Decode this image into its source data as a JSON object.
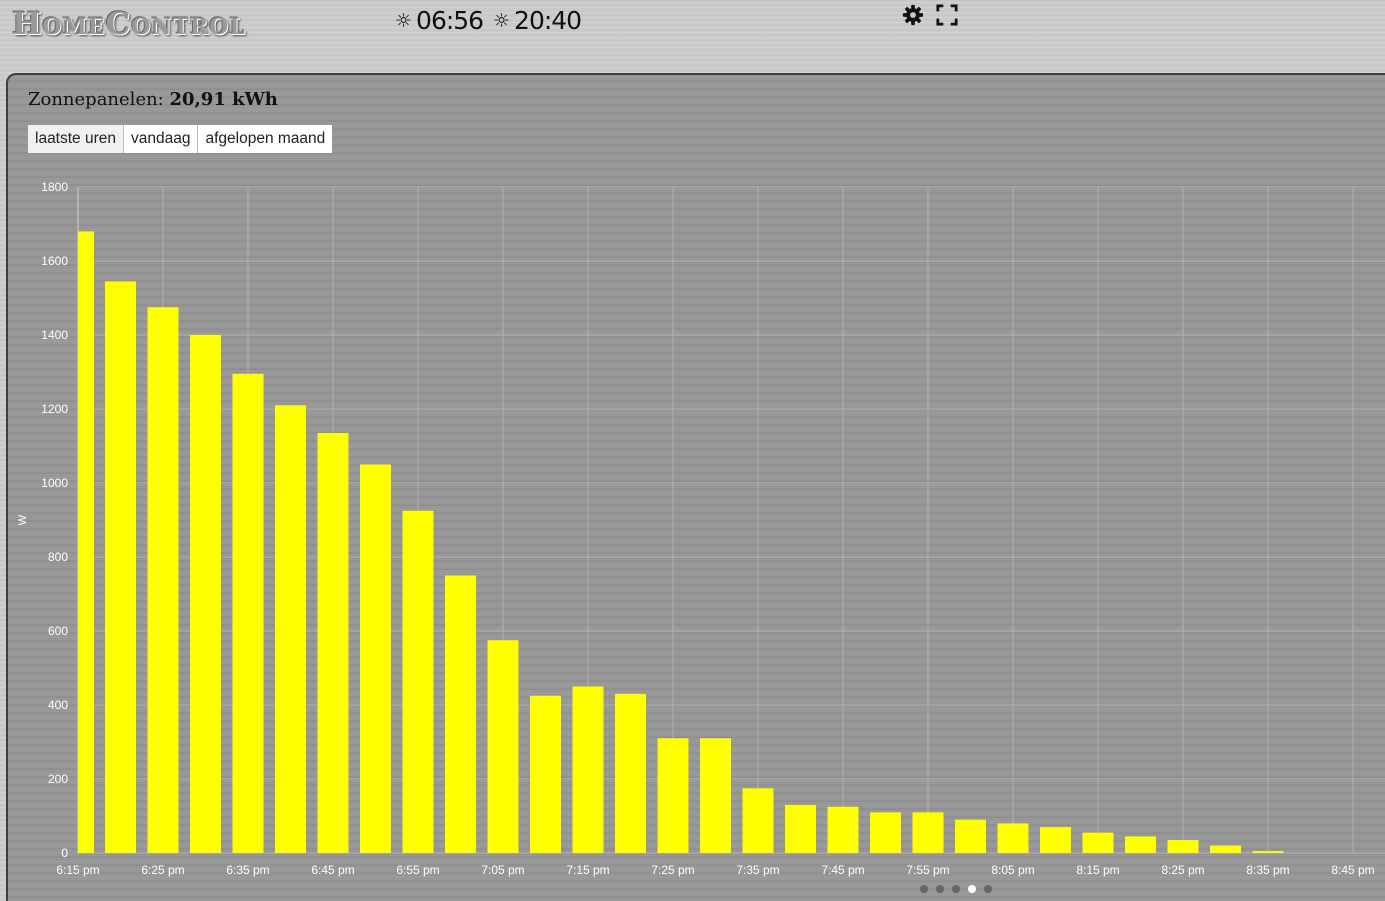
{
  "app": {
    "logo_text": "HomeControl"
  },
  "header": {
    "sunrise_icon": "sunrise-icon",
    "sunrise": "06:56",
    "sunset_icon": "sunset-icon",
    "sunset": "20:40",
    "settings_icon": "gear-icon",
    "fullscreen_icon": "fullscreen-icon"
  },
  "panel": {
    "title_label": "Zonnepanelen:",
    "title_value": "20,91 kWh",
    "tabs": [
      {
        "label": "laatste uren",
        "active": true
      },
      {
        "label": "vandaag",
        "active": false
      },
      {
        "label": "afgelopen maand",
        "active": false
      }
    ]
  },
  "pager": {
    "count": 5,
    "active_index": 3
  },
  "colors": {
    "bar": "#ffff00",
    "grid": "#b8b8b8",
    "tick_text": "#ffffff"
  },
  "chart_data": {
    "type": "bar",
    "title": "",
    "xlabel": "",
    "ylabel": "W",
    "ylim": [
      0,
      1800
    ],
    "yticks": [
      0,
      200,
      400,
      600,
      800,
      1000,
      1200,
      1400,
      1600,
      1800
    ],
    "x_tick_labels": [
      "6:15 pm",
      "6:25 pm",
      "6:35 pm",
      "6:45 pm",
      "6:55 pm",
      "7:05 pm",
      "7:15 pm",
      "7:25 pm",
      "7:35 pm",
      "7:45 pm",
      "7:55 pm",
      "8:05 pm",
      "8:15 pm",
      "8:25 pm",
      "8:35 pm",
      "8:45 pm"
    ],
    "grid": true,
    "legend": false,
    "categories": [
      "6:15 pm",
      "6:20 pm",
      "6:25 pm",
      "6:30 pm",
      "6:35 pm",
      "6:40 pm",
      "6:45 pm",
      "6:50 pm",
      "6:55 pm",
      "7:00 pm",
      "7:05 pm",
      "7:10 pm",
      "7:15 pm",
      "7:20 pm",
      "7:25 pm",
      "7:30 pm",
      "7:35 pm",
      "7:40 pm",
      "7:45 pm",
      "7:50 pm",
      "7:55 pm",
      "8:00 pm",
      "8:05 pm",
      "8:10 pm",
      "8:15 pm",
      "8:20 pm",
      "8:25 pm",
      "8:30 pm",
      "8:35 pm"
    ],
    "values": [
      1680,
      1545,
      1475,
      1400,
      1295,
      1210,
      1135,
      1050,
      925,
      750,
      575,
      425,
      450,
      430,
      310,
      310,
      175,
      130,
      125,
      110,
      110,
      90,
      80,
      70,
      55,
      45,
      35,
      20,
      5
    ]
  }
}
